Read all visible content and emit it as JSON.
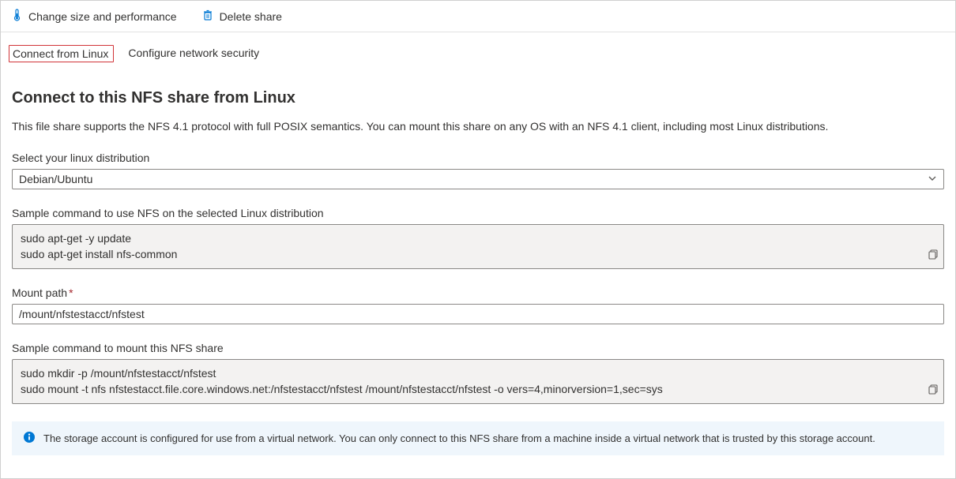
{
  "toolbar": {
    "change_size_label": "Change size and performance",
    "delete_share_label": "Delete share"
  },
  "tabs": {
    "connect_label": "Connect from Linux",
    "network_label": "Configure network security"
  },
  "page": {
    "title": "Connect to this NFS share from Linux",
    "description": "This file share supports the NFS 4.1 protocol with full POSIX semantics. You can mount this share on any OS with an NFS 4.1 client, including most Linux distributions."
  },
  "distro": {
    "label": "Select your linux distribution",
    "selected": "Debian/Ubuntu"
  },
  "install_cmd": {
    "label": "Sample command to use NFS on the selected Linux distribution",
    "text": "sudo apt-get -y update\nsudo apt-get install nfs-common"
  },
  "mount_path": {
    "label": "Mount path",
    "value": "/mount/nfstestacct/nfstest"
  },
  "mount_cmd": {
    "label": "Sample command to mount this NFS share",
    "text": "sudo mkdir -p /mount/nfstestacct/nfstest\nsudo mount -t nfs nfstestacct.file.core.windows.net:/nfstestacct/nfstest /mount/nfstestacct/nfstest -o vers=4,minorversion=1,sec=sys"
  },
  "info_banner": {
    "text": "The storage account is configured for use from a virtual network. You can only connect to this NFS share from a machine inside a virtual network that is trusted by this storage account."
  }
}
